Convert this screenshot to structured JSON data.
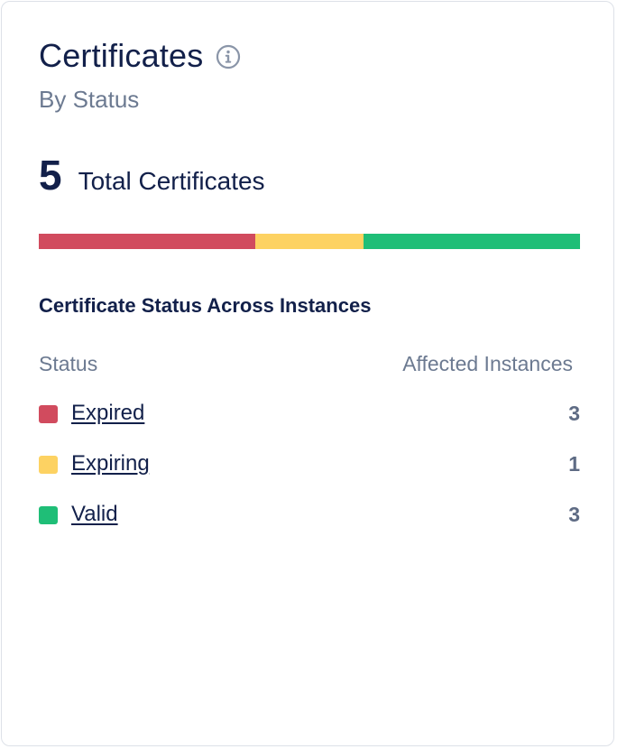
{
  "card": {
    "title": "Certificates",
    "subtitle": "By Status",
    "info_icon": "info-circle-icon"
  },
  "summary": {
    "total_count": "5",
    "total_label": "Total Certificates"
  },
  "status_bar": {
    "segments": [
      {
        "status": "Expired",
        "fraction": 0.4,
        "color": "#d14b5e"
      },
      {
        "status": "Expiring",
        "fraction": 0.2,
        "color": "#fdd262"
      },
      {
        "status": "Valid",
        "fraction": 0.4,
        "color": "#1fbe77"
      }
    ]
  },
  "breakdown": {
    "title": "Certificate Status Across Instances",
    "columns": {
      "status": "Status",
      "affected": "Affected Instances"
    },
    "rows": [
      {
        "label": "Expired",
        "count": "3",
        "color": "#d14b5e"
      },
      {
        "label": "Expiring",
        "count": "1",
        "color": "#fdd262"
      },
      {
        "label": "Valid",
        "count": "3",
        "color": "#1fbe77"
      }
    ]
  }
}
